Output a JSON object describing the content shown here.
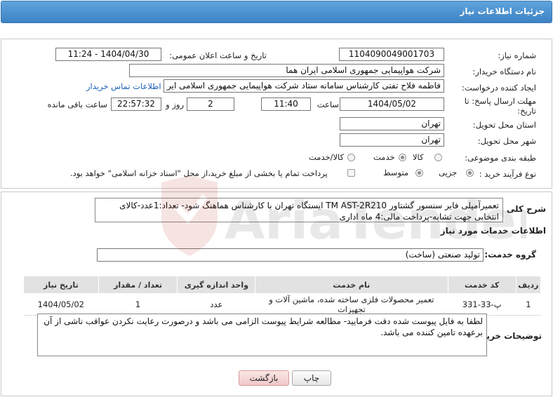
{
  "header": {
    "title": "جزئیات اطلاعات نیاز"
  },
  "form": {
    "need_number_label": "شماره نیاز:",
    "need_number": "1104090049001703",
    "announce_label": "تاریخ و ساعت اعلان عمومی:",
    "announce_value": "1404/04/30 - 11:24",
    "buyer_org_label": "نام دستگاه خریدار:",
    "buyer_org": "شرکت هواپیمایی جمهوری اسلامی ایران هما",
    "creator_label": "ایجاد کننده درخواست:",
    "creator": "فاطمه فلاح تفتی کارشناس سامانه ستاد شرکت هواپیمایی جمهوری اسلامی ایر",
    "contact_link": "اطلاعات تماس خریدار",
    "deadline_label_line1": "مهلت ارسال پاسخ: تا",
    "deadline_label_line2": "تاریخ:",
    "deadline_date": "1404/05/02",
    "time_label": "ساعت",
    "deadline_time": "11:40",
    "days_value": "2",
    "days_label": "روز و",
    "remaining_time": "22:57:32",
    "remaining_label": "ساعت باقی مانده",
    "province_label": "استان محل تحویل:",
    "province": "تهران",
    "city_label": "شهر محل تحویل:",
    "city": "تهران",
    "category_label": "طبقه بندی موضوعی:",
    "category_options": [
      "کالا",
      "خدمت",
      "کالا/خدمت"
    ],
    "category_selected": "خدمت",
    "process_label": "نوع فرآیند خرید :",
    "process_options": [
      "جزیی",
      "متوسط"
    ],
    "process_selected": "جزیی",
    "treasury_note": "پرداخت تمام یا بخشی از مبلغ خرید،از محل \"اسناد خزانه اسلامی\" خواهد بود."
  },
  "summary": {
    "label": "شرح کلی نیاز:",
    "text": "تعمیرآمپلی فایر سنسور گشتاور TM AST-2R210  ایستگاه تهران با کارشناس هماهنگ شود- تعداد:1عدد-کالای انتخابی جهت تشابه-پرداخت مالی:4 ماه اداری"
  },
  "services": {
    "section_title": "اطلاعات خدمات مورد نیاز",
    "group_label": "گروه خدمت:",
    "group_value": "تولید صنعتی (ساخت)",
    "columns": [
      "ردیف",
      "کد خدمت",
      "نام خدمت",
      "واحد اندازه گیری",
      "تعداد / مقدار",
      "تاریخ نیاز"
    ],
    "rows": [
      {
        "index": "1",
        "code": "پ-33-331",
        "name": "تعمیر محصولات فلزی ساخته شده، ماشین آلات و تجهیزات",
        "unit": "عدد",
        "qty": "1",
        "date": "1404/05/02"
      }
    ]
  },
  "buyer_notes": {
    "label": "توضیحات خریدار:",
    "text": "لطفا به فایل پیوست شده دقت فرمایید- مطالعه شرایط پیوست الزامی می باشد و درصورت رعایت نکردن عواقب ناشی از آن برعهده تامین کننده می باشد."
  },
  "buttons": {
    "print": "چاپ",
    "back": "بازگشت"
  },
  "watermark": {
    "text": "AriaTender.neT"
  },
  "colors": {
    "title_bar": "#4a8fd0",
    "link": "#1a5fb4",
    "back_button": "#f0c8c8"
  }
}
